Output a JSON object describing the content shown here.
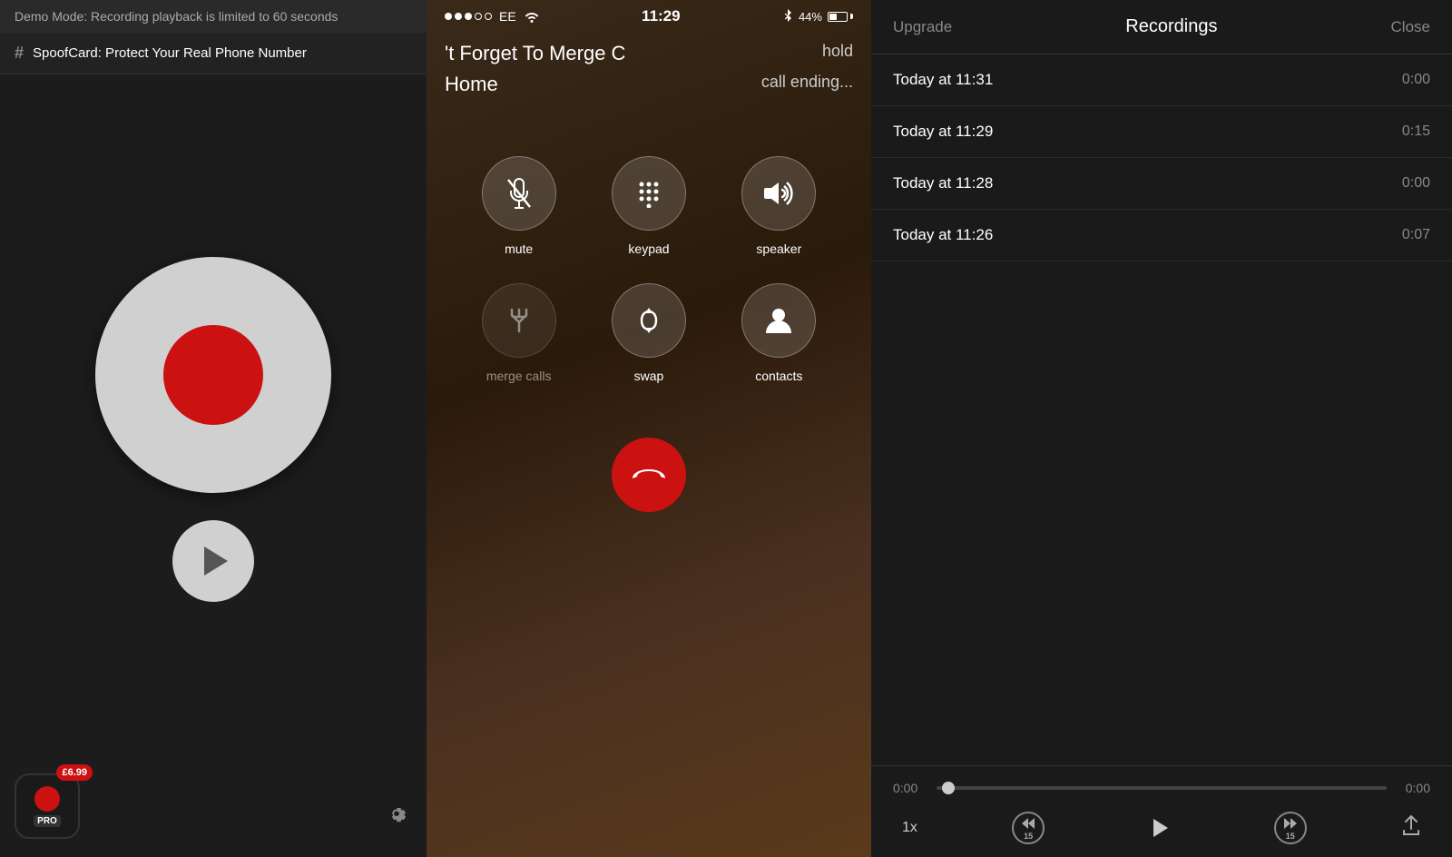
{
  "left": {
    "demo_banner": "Demo Mode: Recording playback is limited to 60 seconds",
    "spoofcard_label": "SpoofCard: Protect Your Real Phone Number",
    "price_badge": "£6.99",
    "pro_label": "PRO",
    "settings_label": "⚙"
  },
  "middle": {
    "status": {
      "carrier": "EE",
      "time": "11:29",
      "battery": "44%"
    },
    "call_title": "'t Forget To Merge C",
    "call_hold": "hold",
    "call_home": "Home",
    "call_ending": "call ending...",
    "buttons": [
      {
        "id": "mute",
        "label": "mute",
        "disabled": false
      },
      {
        "id": "keypad",
        "label": "keypad",
        "disabled": false
      },
      {
        "id": "speaker",
        "label": "speaker",
        "disabled": false
      },
      {
        "id": "merge",
        "label": "merge calls",
        "disabled": true
      },
      {
        "id": "swap",
        "label": "swap",
        "disabled": false
      },
      {
        "id": "contacts",
        "label": "contacts",
        "disabled": false
      }
    ]
  },
  "right": {
    "header": {
      "upgrade": "Upgrade",
      "title": "Recordings",
      "close": "Close"
    },
    "recordings": [
      {
        "label": "Today at 11:31",
        "duration": "0:00"
      },
      {
        "label": "Today at 11:29",
        "duration": "0:15"
      },
      {
        "label": "Today at 11:28",
        "duration": "0:00"
      },
      {
        "label": "Today at 11:26",
        "duration": "0:07"
      }
    ],
    "playback": {
      "time_start": "0:00",
      "time_end": "0:00",
      "speed": "1x",
      "skip_back": "15",
      "skip_fwd": "15"
    }
  }
}
